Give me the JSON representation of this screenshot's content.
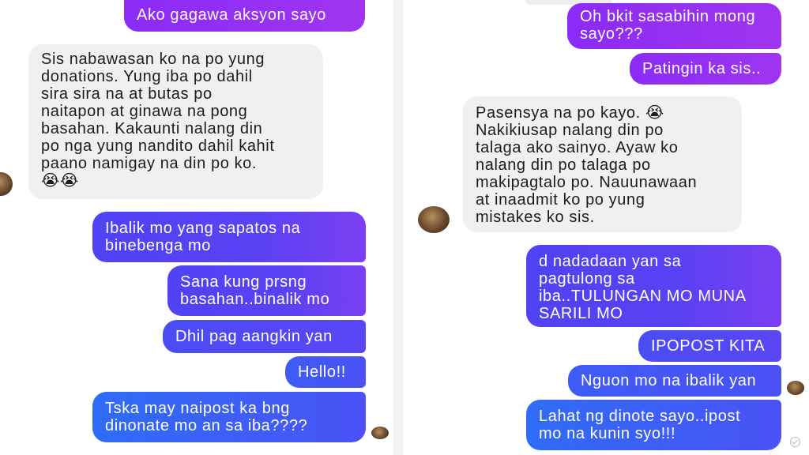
{
  "left_chat": {
    "messages": [
      {
        "text": "Ako gagawa aksyon sayo"
      },
      {
        "text": "Sis nabawasan ko na po yung\ndonations. Yung iba po dahil\nsira sira na at butas po\nnaitapon at ginawa na pong\nbasahan. Kakaunti nalang din\npo nga yung nandito dahil kahit\npaano namigay na din po ko.\n😭😭"
      },
      {
        "text": "Ibalik mo yang sapatos na\nbinebenga mo"
      },
      {
        "text": "Sana kung prsng\nbasahan..binalik mo"
      },
      {
        "text": "Dhil pag aangkin yan"
      },
      {
        "text": "Hello!!"
      },
      {
        "text": "Tska may naipost ka bng\ndinonate mo an sa iba????"
      }
    ]
  },
  "right_chat": {
    "messages": [
      {
        "text": "Oh bkit sasabihin mong\nsayo???"
      },
      {
        "text": "Patingin ka sis.."
      },
      {
        "text": "Pasensya na po kayo. 😭\nNakikiusap nalang din po\ntalaga ako sainyo. Ayaw ko\nnalang din po talaga po\nmakipagtalo po. Nauunawaan\nat inaadmit ko po yung\nmistakes ko sis."
      },
      {
        "text": "d nadadaan yan sa\npagtulong sa\niba..TULUNGAN MO MUNA\nSARILI MO"
      },
      {
        "text": "IPOPOST KITA"
      },
      {
        "text": "Nguon mo na ibalik yan"
      },
      {
        "text": "Lahat ng dinote sayo..ipost\nmo na kunin syo!!!"
      }
    ]
  }
}
